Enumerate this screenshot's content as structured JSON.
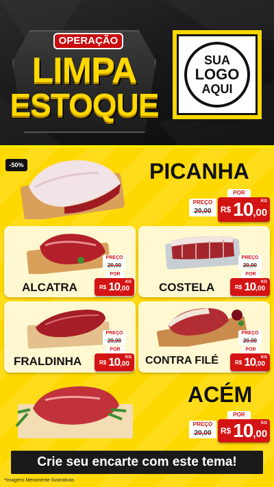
{
  "header": {
    "operation_label": "OPERAÇÃO",
    "title_line1": "LIMPA",
    "title_line2": "ESTOQUE",
    "logo_line1": "SUA",
    "logo_line2": "LOGO",
    "logo_line3": "AQUI"
  },
  "colors": {
    "accent_yellow": "#ffd800",
    "price_red": "#d41414",
    "dark": "#111111"
  },
  "discount_badge": "-50%",
  "price_labels": {
    "preco": "PREÇO",
    "por": "POR",
    "currency": "R$",
    "unit": "KG"
  },
  "products": [
    {
      "name": "PICANHA",
      "old_price": "20,00",
      "new_int": "10",
      "new_dec": ",00"
    },
    {
      "name": "ALCATRA",
      "old_price": "20,00",
      "new_int": "10",
      "new_dec": ",00"
    },
    {
      "name": "COSTELA",
      "old_price": "20,00",
      "new_int": "10",
      "new_dec": ",00"
    },
    {
      "name": "FRALDINHA",
      "old_price": "20,00",
      "new_int": "10",
      "new_dec": ",00"
    },
    {
      "name": "CONTRA FILÉ",
      "old_price": "20,00",
      "new_int": "10",
      "new_dec": ",00"
    },
    {
      "name": "ACÉM",
      "old_price": "20,00",
      "new_int": "10",
      "new_dec": ",00"
    }
  ],
  "footer": {
    "cta": "Crie seu encarte com este tema!",
    "disclaimer": "*Imagens Meramente Ilustrativas"
  }
}
